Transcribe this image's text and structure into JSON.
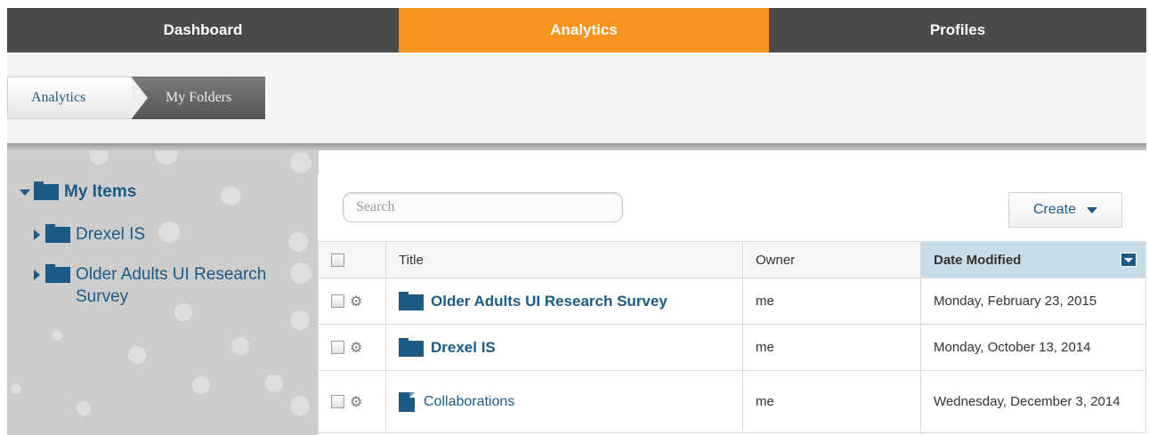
{
  "nav": {
    "tabs": [
      {
        "label": "Dashboard",
        "active": false
      },
      {
        "label": "Analytics",
        "active": true
      },
      {
        "label": "Profiles",
        "active": false
      }
    ]
  },
  "breadcrumb": [
    "Analytics",
    "My Folders"
  ],
  "tree": {
    "root": "My Items",
    "children": [
      "Drexel IS",
      "Older Adults UI Research Survey"
    ]
  },
  "search": {
    "placeholder": "Search"
  },
  "create_label": "Create",
  "table": {
    "headers": {
      "title": "Title",
      "owner": "Owner",
      "date": "Date Modified"
    },
    "rows": [
      {
        "title": "Older Adults UI Research Survey",
        "type": "folder",
        "owner": "me",
        "date": "Monday, February 23, 2015"
      },
      {
        "title": "Drexel IS",
        "type": "folder",
        "owner": "me",
        "date": "Monday, October 13, 2014"
      },
      {
        "title": "Collaborations",
        "type": "document",
        "owner": "me",
        "date": "Wednesday, December 3, 2014"
      }
    ]
  },
  "colors": {
    "accent": "#f7941d",
    "nav_bg": "#4a4a4a",
    "link": "#1c5a86",
    "sorted_header": "#c9dde8"
  },
  "icons": [
    "folder-icon",
    "document-icon",
    "gear-icon",
    "checkbox-icon",
    "sort-dropdown-icon"
  ]
}
